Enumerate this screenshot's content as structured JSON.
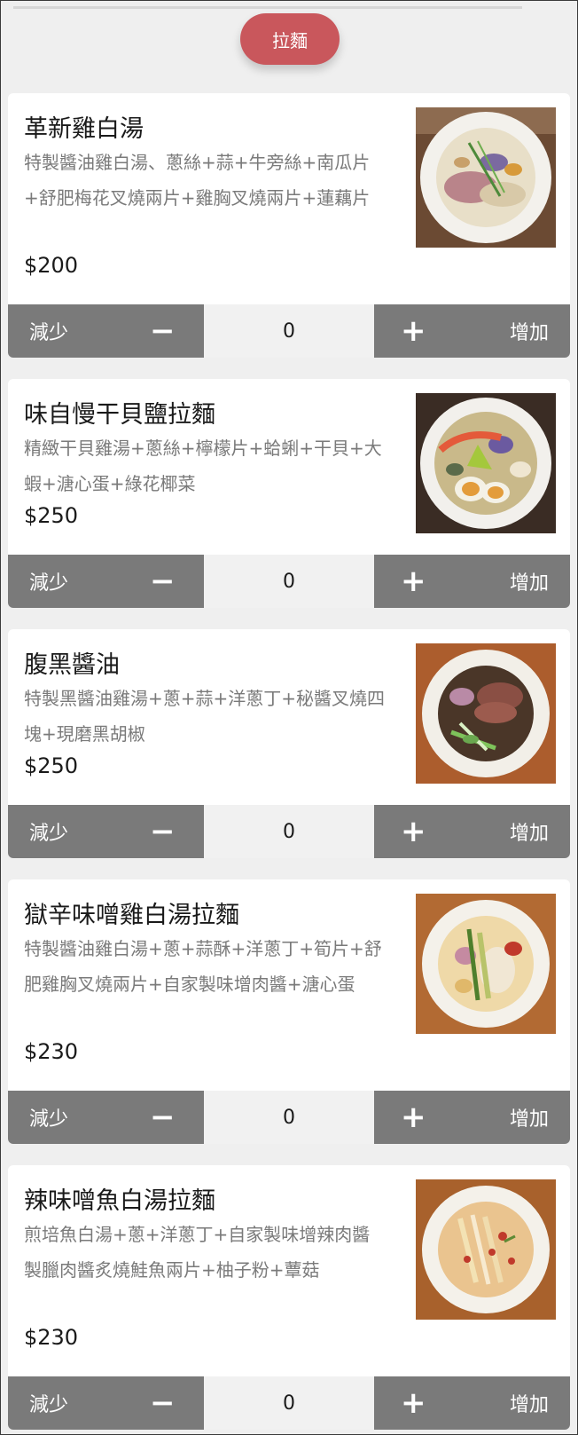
{
  "category": {
    "label": "拉麵",
    "color": "#c9575c"
  },
  "controls": {
    "decrease_label": "減少",
    "increase_label": "增加",
    "minus_symbol": "−",
    "plus_symbol": "+"
  },
  "items": [
    {
      "name": "革新雞白湯",
      "desc": "特製醬油雞白湯、蔥絲+蒜+牛旁絲+南瓜片+舒肥梅花叉燒兩片+雞胸叉燒兩片+蓮藕片",
      "price": "$200",
      "qty": "0"
    },
    {
      "name": "味自慢干貝鹽拉麵",
      "desc": "精緻干貝雞湯+蔥絲+檸檬片+蛤蜊+干貝+大蝦+溏心蛋+綠花椰菜",
      "price": "$250",
      "qty": "0"
    },
    {
      "name": "腹黑醬油",
      "desc": "特製黑醬油雞湯+蔥+蒜+洋蔥丁+秘醬叉燒四塊+現磨黑胡椒",
      "price": "$250",
      "qty": "0"
    },
    {
      "name": "獄辛味噌雞白湯拉麵",
      "desc": "特製醬油雞白湯+蔥+蒜酥+洋蔥丁+筍片+舒肥雞胸叉燒兩片+自家製味增肉醬+溏心蛋",
      "price": "$230",
      "qty": "0"
    },
    {
      "name": "辣味噌魚白湯拉麵",
      "desc": "煎培魚白湯+蔥+洋蔥丁+自家製味增辣肉醬製臘肉醬炙燒鮭魚兩片+柚子粉+蕈菇",
      "price": "$230",
      "qty": "0"
    }
  ]
}
